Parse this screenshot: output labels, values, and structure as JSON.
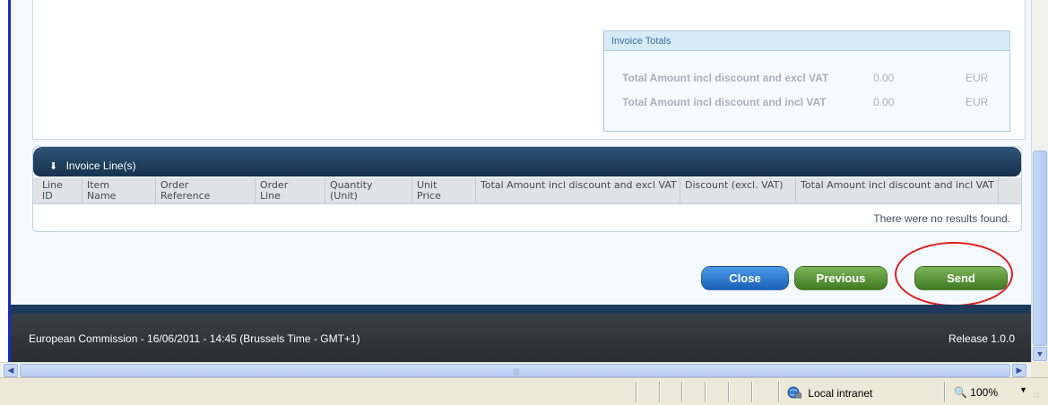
{
  "invoice_totals": {
    "title": "Invoice Totals",
    "rows": [
      {
        "label": "Total Amount incl discount and excl VAT",
        "value": "0.00",
        "currency": "EUR"
      },
      {
        "label": "Total Amount incl discount and incl VAT",
        "value": "0.00",
        "currency": "EUR"
      }
    ]
  },
  "invoice_lines": {
    "title": "Invoice Line(s)",
    "columns": [
      "Line ID",
      "Item Name",
      "Order Reference",
      "Order Line",
      "Quantity (Unit)",
      "Unit Price",
      "Total Amount incl discount and excl VAT",
      "Discount (excl. VAT)",
      "Total Amount incl discount and incl VAT"
    ],
    "empty_message": "There were no results found."
  },
  "actions": {
    "close_label": "Close",
    "previous_label": "Previous",
    "send_label": "Send"
  },
  "footer": {
    "left_text": "European Commission - 16/06/2011 - 14:45 (Brussels Time - GMT+1)",
    "release_text": "Release 1.0.0"
  },
  "status_bar": {
    "zone_label": "Local intranet",
    "zoom_label": "100%"
  },
  "colors": {
    "accent_dark": "#1d3a5c",
    "button_blue": "#1a61b8",
    "button_green": "#3f7a23",
    "highlight_red": "#e01d1d"
  }
}
